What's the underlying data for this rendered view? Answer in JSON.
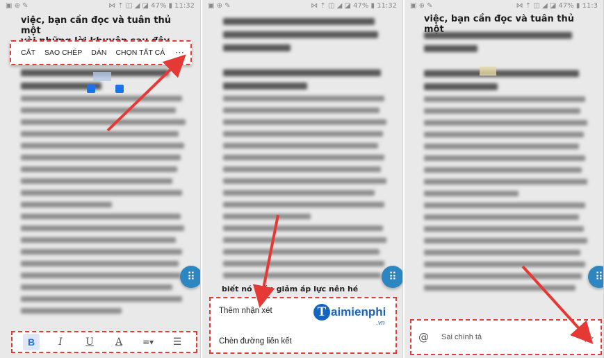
{
  "panels": [
    {
      "status": {
        "left_icons": "▣ ⊕ ✎",
        "right": "⋈ ⇡ ◫ ◢ ◪ 47% ▮ 11:32"
      },
      "heading_lines": [
        "việc, bạn cần đọc và tuân thủ một",
        "vài những lời khuyên sau đây của"
      ],
      "selection_toolbar": [
        "CẮT",
        "SAO CHÉP",
        "DÁN",
        "CHỌN TẤT CẢ"
      ],
      "more_icon": "⋯",
      "format_toolbar": [
        "B",
        "I",
        "U",
        "A",
        "≡▾",
        "☰"
      ]
    },
    {
      "status": {
        "left_icons": "▣ ⊕ ✎",
        "right": "⋈ ⇡ ◫ ◢ ◪ 47% ▮ 11:32"
      },
      "visible_text": "biết  nó  giúp giảm áp lực nên hé",
      "menu_items": [
        "Thêm nhận xét",
        "Chèn đường liên kết"
      ],
      "logo": {
        "letter": "T",
        "word": "aimienphi",
        "suffix": ".vn"
      }
    },
    {
      "status": {
        "left_icons": "▣ ⊕ ✎",
        "right": "⋈ ⇡ ◫ ◢ ◪ 47% ▮ 11:3"
      },
      "heading_lines": [
        "việc, bạn cần đọc và tuân thủ một"
      ],
      "spell_bar": {
        "at_icon": "@",
        "text": "Sai chính tả",
        "send_icon": "▷"
      }
    }
  ],
  "colors": {
    "highlight": "#e53935",
    "accent": "#1a73e8",
    "fab": "#2e86c1",
    "logo": "#1565c0"
  },
  "icons": [
    "grid-fab-icon",
    "more-options-icon",
    "send-icon",
    "at-mention-icon",
    "bold-icon",
    "italic-icon",
    "underline-icon",
    "text-color-icon",
    "align-icon",
    "list-icon"
  ]
}
